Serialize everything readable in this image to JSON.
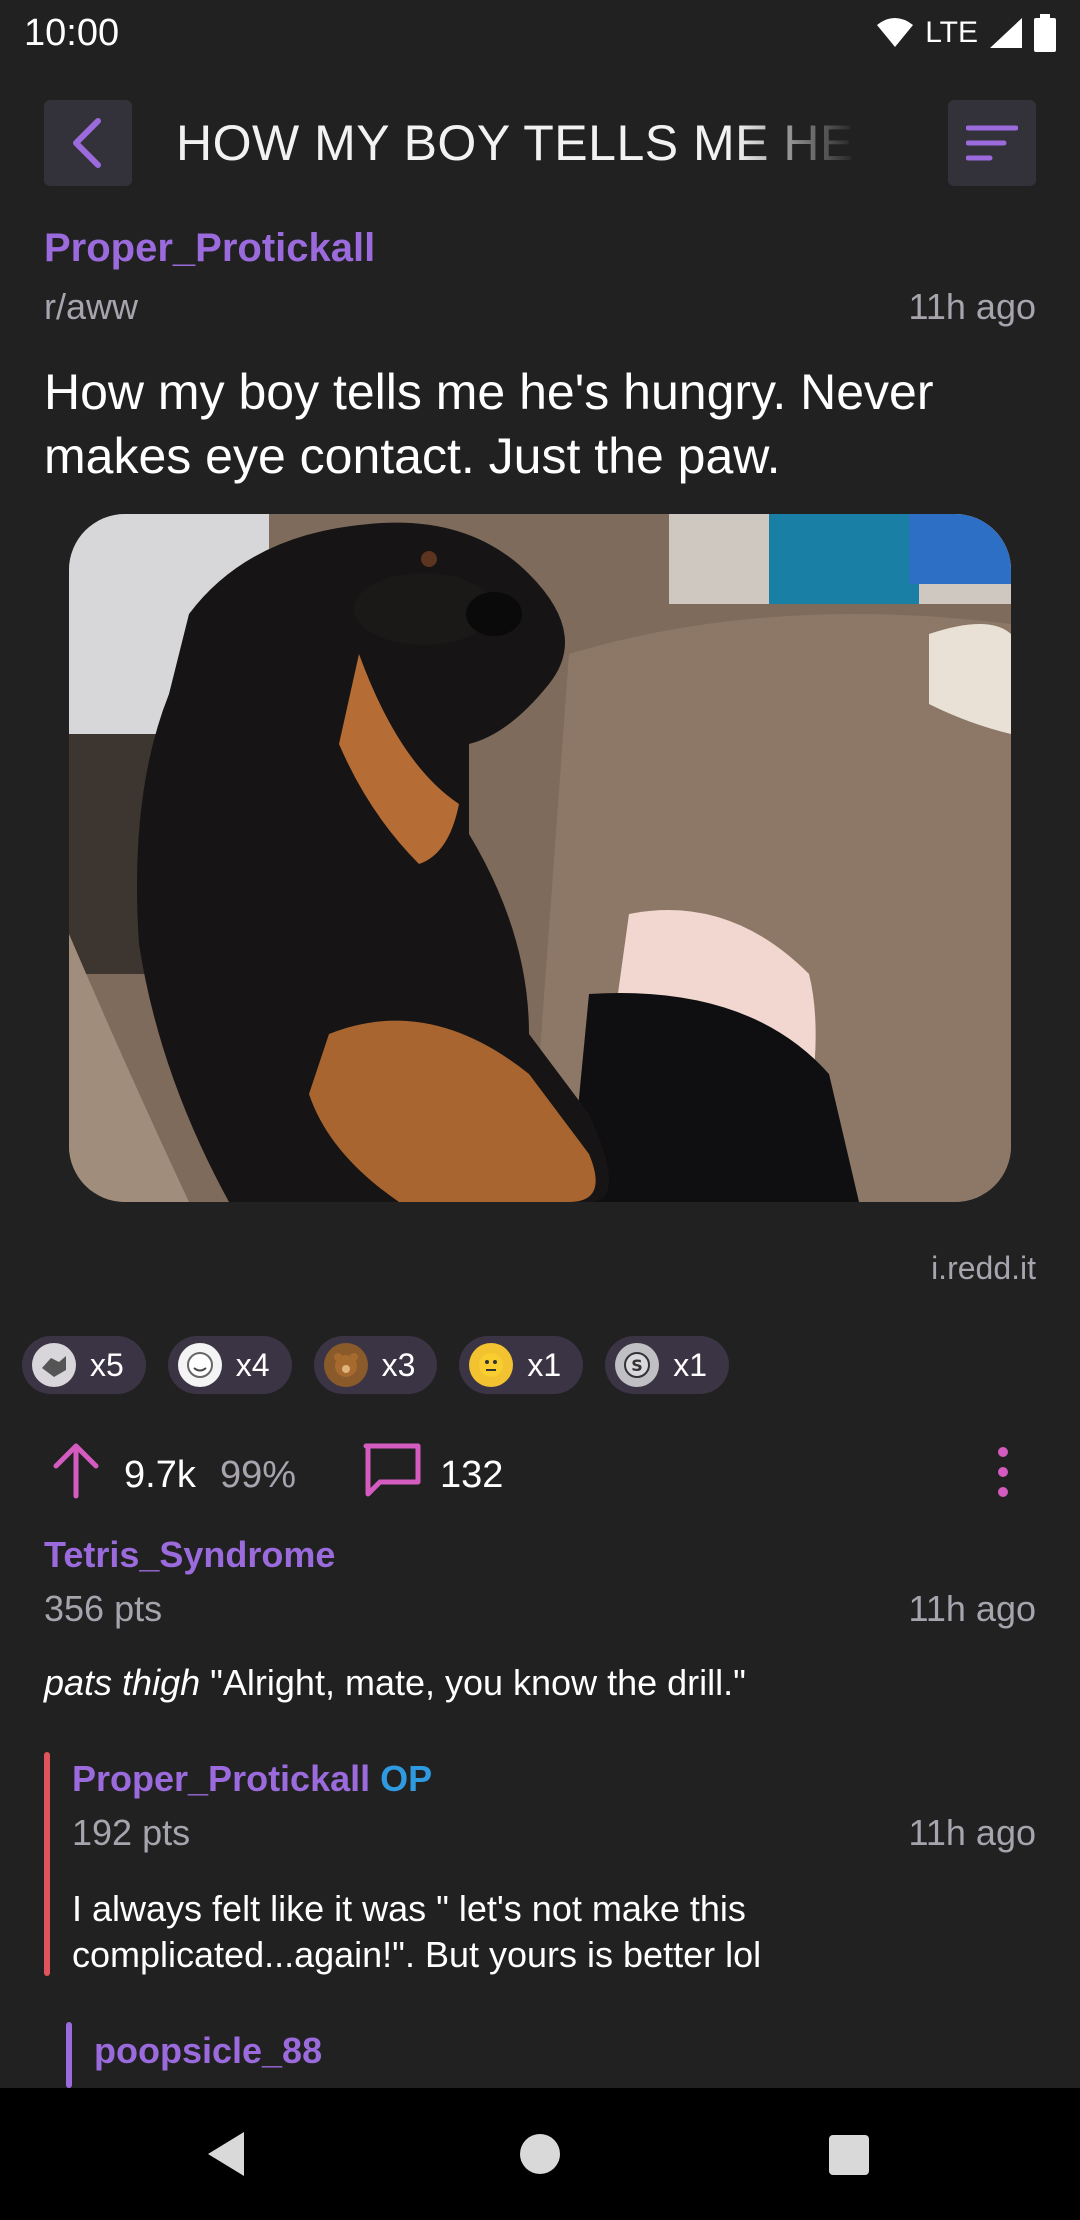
{
  "status_bar": {
    "time": "10:00",
    "network": "LTE"
  },
  "toolbar": {
    "title": "HOW MY BOY TELLS ME HE'S HUNGRY. NEVER MAKES EYE CONTACT. JUST THE PAW."
  },
  "post": {
    "author": "Proper_Protickall",
    "subreddit": "r/aww",
    "time": "11h ago",
    "title": "How my boy tells me he's hungry. Never makes eye contact. Just the paw.",
    "domain": "i.redd.it",
    "awards": [
      {
        "icon": "handshake-award-icon",
        "count": "x5"
      },
      {
        "icon": "face-award-icon",
        "count": "x4"
      },
      {
        "icon": "bear-award-icon",
        "count": "x3"
      },
      {
        "icon": "yellow-face-award-icon",
        "count": "x1"
      },
      {
        "icon": "silver-award-icon",
        "count": "x1"
      }
    ],
    "score": "9.7k",
    "upvote_ratio": "99%",
    "comment_count": "132"
  },
  "comments": [
    {
      "author": "Tetris_Syndrome",
      "points": "356 pts",
      "time": "11h ago",
      "body_italic": "pats thigh",
      "body": " \"Alright, mate, you know the drill.\""
    },
    {
      "author": "Proper_Protickall",
      "op_badge": "OP",
      "points": "192 pts",
      "time": "11h ago",
      "body": "I always felt like it was \" let's not make this complicated...again!\". But yours is better lol"
    },
    {
      "author": "poopsicle_88"
    }
  ],
  "colors": {
    "accent": "#9b6bdd",
    "pink": "#d45bbf",
    "op_blue": "#2f9ae0",
    "thread_red": "#e0555c",
    "thread_purple": "#9b6bdd"
  }
}
